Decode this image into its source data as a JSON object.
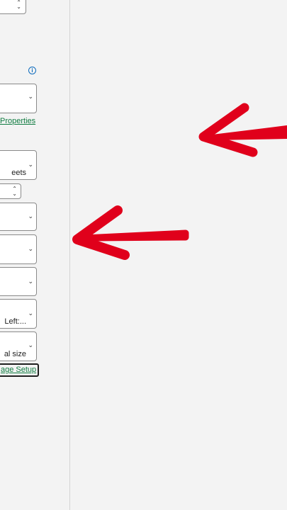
{
  "panel": {
    "info_icon_glyph": "i",
    "properties_link": "Properties",
    "sheets_select_value": "eets",
    "margins_select_value": "Left:...",
    "scaling_select_value": "al size",
    "page_setup_link": "age Setup"
  },
  "glyphs": {
    "chevron": "⌄",
    "spin_up": "⌃",
    "spin_down": "⌄"
  },
  "colors": {
    "arrow": "#e0001b",
    "link": "#107c41",
    "info": "#0f6cbd"
  }
}
